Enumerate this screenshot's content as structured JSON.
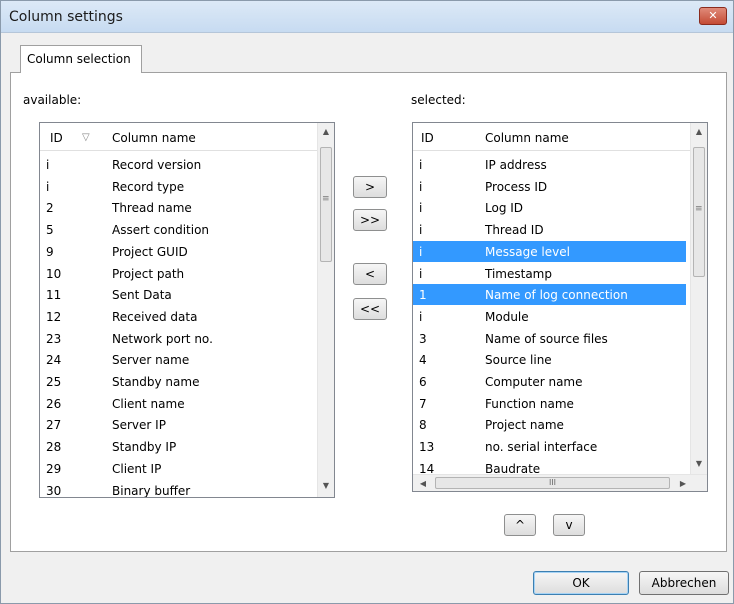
{
  "window": {
    "title": "Column settings",
    "close_glyph": "✕"
  },
  "tabs": [
    {
      "label": "Column selection"
    }
  ],
  "available": {
    "label": "available:",
    "headers": {
      "id": "ID",
      "sort_glyph": "▽",
      "name": "Column name"
    },
    "rows": [
      {
        "id": "i",
        "name": "Record version"
      },
      {
        "id": "i",
        "name": "Record type"
      },
      {
        "id": "2",
        "name": "Thread name"
      },
      {
        "id": "5",
        "name": "Assert condition"
      },
      {
        "id": "9",
        "name": "Project GUID"
      },
      {
        "id": "10",
        "name": "Project path"
      },
      {
        "id": "11",
        "name": "Sent Data"
      },
      {
        "id": "12",
        "name": "Received data"
      },
      {
        "id": "23",
        "name": "Network port no."
      },
      {
        "id": "24",
        "name": "Server name"
      },
      {
        "id": "25",
        "name": "Standby name"
      },
      {
        "id": "26",
        "name": "Client name"
      },
      {
        "id": "27",
        "name": "Server IP"
      },
      {
        "id": "28",
        "name": "Standby IP"
      },
      {
        "id": "29",
        "name": "Client IP"
      },
      {
        "id": "30",
        "name": "Binary buffer"
      }
    ]
  },
  "selected": {
    "label": "selected:",
    "headers": {
      "id": "ID",
      "name": "Column name"
    },
    "rows": [
      {
        "id": "i",
        "name": "IP address",
        "selected": false
      },
      {
        "id": "i",
        "name": "Process ID",
        "selected": false
      },
      {
        "id": "i",
        "name": "Log ID",
        "selected": false
      },
      {
        "id": "i",
        "name": "Thread ID",
        "selected": false
      },
      {
        "id": "i",
        "name": "Message level",
        "selected": true
      },
      {
        "id": "i",
        "name": "Timestamp",
        "selected": false
      },
      {
        "id": "1",
        "name": "Name of log connection",
        "selected": true
      },
      {
        "id": "i",
        "name": "Module",
        "selected": false
      },
      {
        "id": "3",
        "name": "Name of source files",
        "selected": false
      },
      {
        "id": "4",
        "name": "Source line",
        "selected": false
      },
      {
        "id": "6",
        "name": "Computer name",
        "selected": false
      },
      {
        "id": "7",
        "name": "Function name",
        "selected": false
      },
      {
        "id": "8",
        "name": "Project name",
        "selected": false
      },
      {
        "id": "13",
        "name": "no. serial interface",
        "selected": false
      },
      {
        "id": "14",
        "name": "Baudrate",
        "selected": false
      }
    ]
  },
  "move_buttons": {
    "add": ">",
    "add_all": ">>",
    "remove": "<",
    "remove_all": "<<"
  },
  "order_buttons": {
    "up": "^",
    "down": "v"
  },
  "scroll_glyphs": {
    "up": "▲",
    "down": "▼",
    "left": "◀",
    "right": "▶",
    "grip_v": "≡",
    "grip_h": "III"
  },
  "footer": {
    "ok": "OK",
    "cancel": "Abbrechen"
  },
  "colors": {
    "selection": "#3399ff",
    "title_bar": "#c7dbf1",
    "close_button": "#c44b35"
  }
}
